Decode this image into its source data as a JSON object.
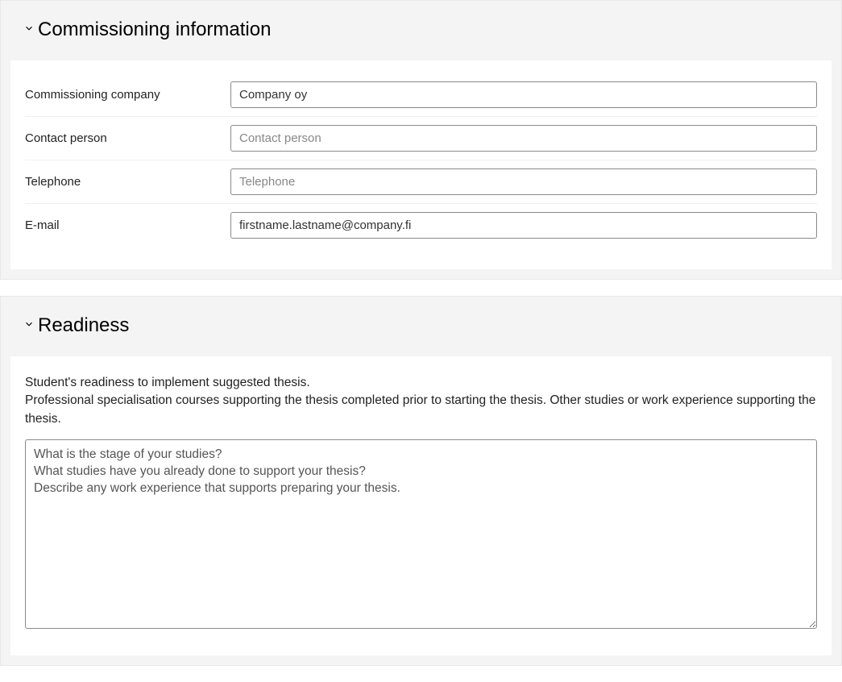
{
  "commissioning": {
    "title": "Commissioning information",
    "fields": {
      "company": {
        "label": "Commissioning company",
        "value": "Company oy",
        "placeholder": ""
      },
      "contact": {
        "label": "Contact person",
        "value": "",
        "placeholder": "Contact person"
      },
      "telephone": {
        "label": "Telephone",
        "value": "",
        "placeholder": "Telephone"
      },
      "email": {
        "label": "E-mail",
        "value": "firstname.lastname@company.fi",
        "placeholder": ""
      }
    }
  },
  "readiness": {
    "title": "Readiness",
    "descLine1": "Student's readiness to implement suggested thesis.",
    "descLine2": "Professional specialisation courses supporting the thesis completed prior to starting the thesis. Other studies or work experience supporting the thesis.",
    "textarea_value": "What is the stage of your studies?\nWhat studies have you already done to support your thesis?\nDescribe any work experience that supports preparing your thesis."
  }
}
